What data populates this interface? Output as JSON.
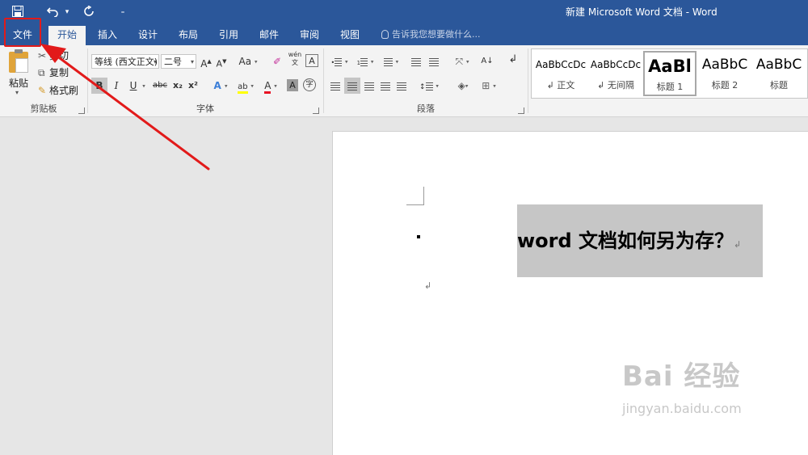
{
  "window": {
    "title": "新建 Microsoft Word 文档 - Word"
  },
  "quick_access": {
    "save_icon": "save-icon",
    "undo_icon": "undo-icon",
    "redo_icon": "redo-icon",
    "customize_icon": "customize-qat-icon"
  },
  "tabs": [
    {
      "label": "文件"
    },
    {
      "label": "开始"
    },
    {
      "label": "插入"
    },
    {
      "label": "设计"
    },
    {
      "label": "布局"
    },
    {
      "label": "引用"
    },
    {
      "label": "邮件"
    },
    {
      "label": "审阅"
    },
    {
      "label": "视图"
    }
  ],
  "tell_me": {
    "placeholder": "告诉我您想要做什么..."
  },
  "clipboard": {
    "paste": "粘贴",
    "cut": "剪切",
    "copy": "复制",
    "format_painter": "格式刷",
    "group_label": "剪贴板"
  },
  "font": {
    "name": "等线 (西文正文)",
    "size": "二号",
    "grow": "A",
    "shrink": "A",
    "case": "Aa",
    "bold": "B",
    "italic": "I",
    "underline": "U",
    "strike": "abc",
    "subscript": "x₂",
    "superscript": "x²",
    "highlight": "ab",
    "color": "A",
    "char_shade": "A",
    "enclose": "字",
    "phonetic": "wén",
    "group_label": "字体"
  },
  "paragraph": {
    "group_label": "段落"
  },
  "styles": {
    "items": [
      {
        "sample": "AaBbCcDc",
        "name": "↲ 正文"
      },
      {
        "sample": "AaBbCcDc",
        "name": "↲ 无间隔"
      },
      {
        "sample": "AaBl",
        "name": "标题 1"
      },
      {
        "sample": "AaBbC",
        "name": "标题 2"
      },
      {
        "sample": "AaBbC",
        "name": "标题"
      }
    ]
  },
  "document": {
    "heading": "word 文档如何另为存？",
    "paragraph_mark": "↲"
  },
  "watermark": {
    "main": "Bai 经验",
    "sub": "jingyan.baidu.com"
  },
  "annotation": {
    "color": "#e21a1a"
  },
  "colors": {
    "accent": "#2b579a",
    "highlight_yellow": "#ffff00",
    "font_red": "#e81123"
  }
}
